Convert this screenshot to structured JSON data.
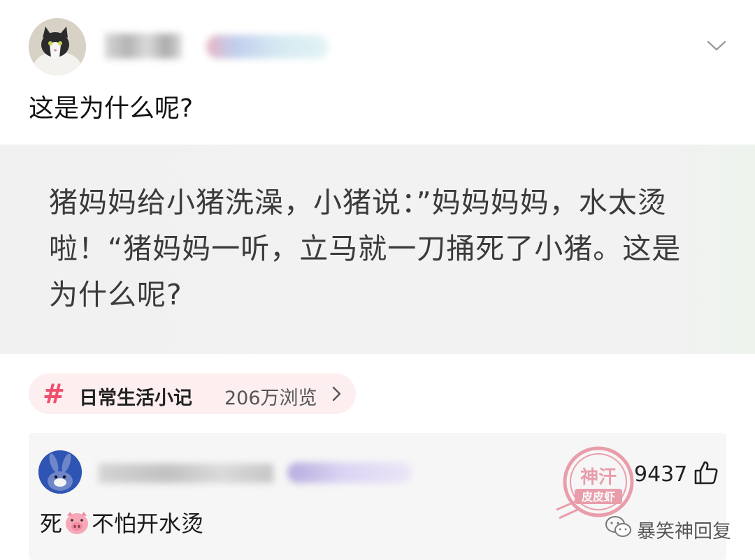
{
  "post": {
    "title": "这是为什么呢?",
    "quote": "猪妈妈给小猪洗澡，小猪说：”妈妈妈妈，水太烫啦！“猪妈妈一听，立马就一刀捅死了小猪。这是为什么呢?"
  },
  "topic": {
    "hash": "#",
    "name": "日常生活小记",
    "views": "206万浏览"
  },
  "comment": {
    "likes": "9437",
    "text_before": "死",
    "emoji": "pig-face-icon",
    "text_after": "不怕开水烫"
  },
  "watermark": {
    "text": "暴笑神回复",
    "stamp_top": "神汗",
    "stamp_bottom": "皮皮虾"
  },
  "colors": {
    "accent": "#f0506e",
    "chip_bg": "#fdeef0",
    "card_bg": "#f2f2f2"
  }
}
